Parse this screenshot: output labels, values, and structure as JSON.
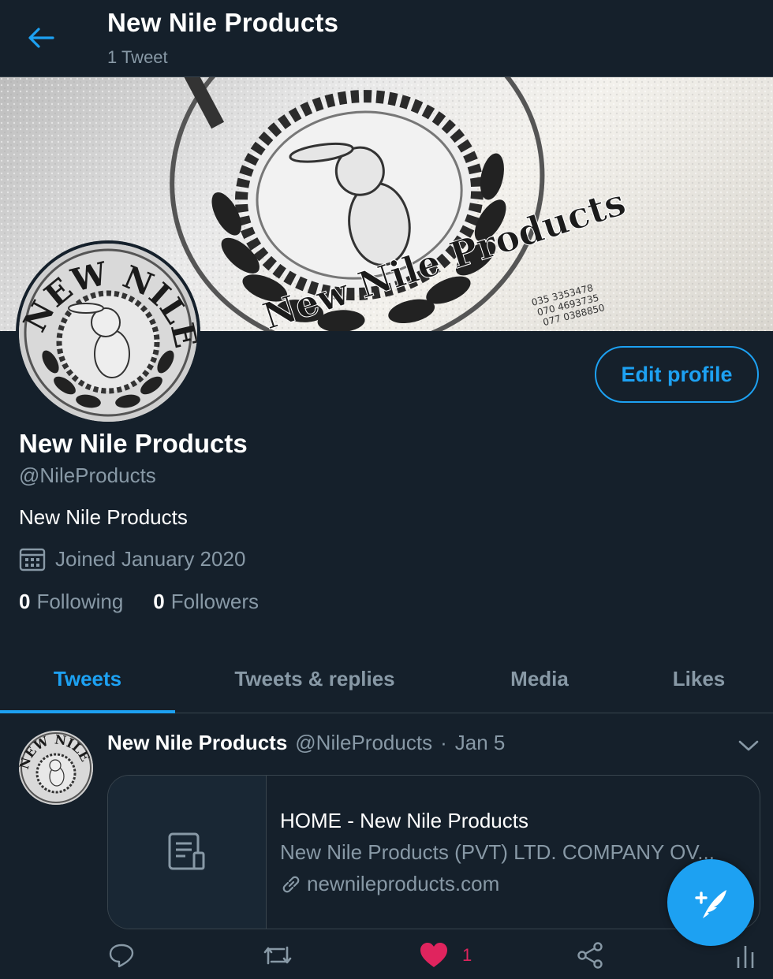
{
  "header": {
    "title": "New Nile Products",
    "subtitle": "1 Tweet"
  },
  "profile": {
    "name": "New Nile Products",
    "handle": "@NileProducts",
    "bio": "New Nile Products",
    "joined": "Joined January 2020",
    "following_count": "0",
    "following_label": "Following",
    "followers_count": "0",
    "followers_label": "Followers",
    "edit_button": "Edit profile",
    "avatar_text": "NEW NILE"
  },
  "banner": {
    "brand_text": "New Nile Products",
    "phones": [
      "035 3353478",
      "070 4693735",
      "077 0388850"
    ]
  },
  "tabs": [
    {
      "label": "Tweets",
      "active": true
    },
    {
      "label": "Tweets & replies",
      "active": false
    },
    {
      "label": "Media",
      "active": false
    },
    {
      "label": "Likes",
      "active": false
    }
  ],
  "tweet": {
    "author_name": "New Nile Products",
    "author_handle": "@NileProducts",
    "separator": "·",
    "date": "Jan 5",
    "card": {
      "title": "HOME - New Nile Products",
      "description": "New Nile Products (PVT) LTD. COMPANY OV...",
      "domain": "newnileproducts.com"
    },
    "like_count": "1"
  },
  "colors": {
    "background": "#15202b",
    "accent": "#1da1f2",
    "muted": "#8899a6",
    "border": "#38444d",
    "like": "#e0245e"
  },
  "icons": [
    "back-arrow-icon",
    "calendar-icon",
    "document-icon",
    "link-icon",
    "reply-icon",
    "retweet-icon",
    "heart-icon",
    "share-icon",
    "analytics-icon",
    "chevron-down-icon",
    "compose-tweet-icon"
  ]
}
